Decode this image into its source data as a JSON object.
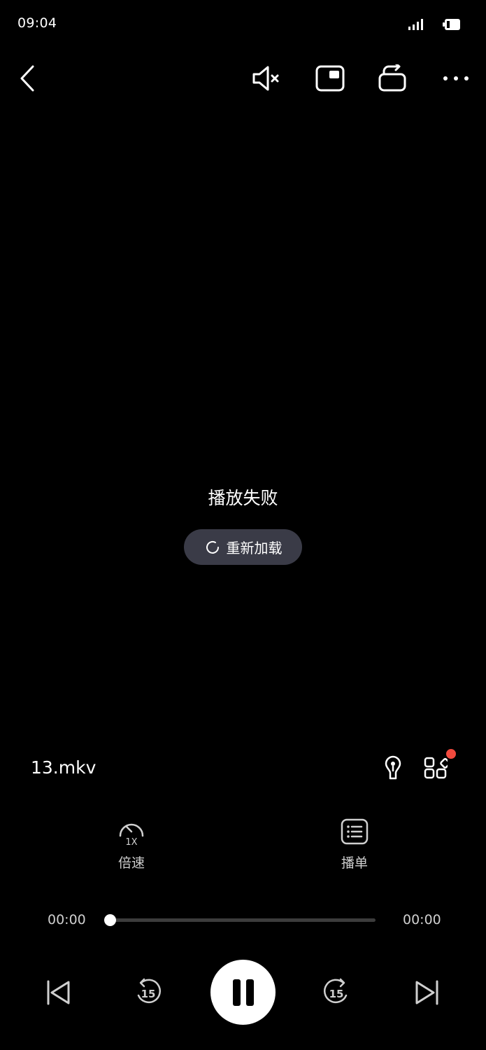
{
  "status_bar": {
    "time": "09:04"
  },
  "top_bar": {
    "back": "back-icon",
    "mute": "mute-icon",
    "pip": "picture-in-picture-icon",
    "rotate": "rotate-screen-icon",
    "more": "more-icon"
  },
  "player": {
    "error_message": "播放失败",
    "reload_label": "重新加载"
  },
  "file": {
    "name": "13.mkv"
  },
  "features": {
    "speed_value": "1X",
    "speed_label": "倍速",
    "playlist_label": "播单"
  },
  "progress": {
    "current_time": "00:00",
    "total_time": "00:00",
    "fraction": 0
  },
  "colors": {
    "background": "#000000",
    "reload_button": "#3a3b47",
    "badge": "#f24a3e"
  }
}
